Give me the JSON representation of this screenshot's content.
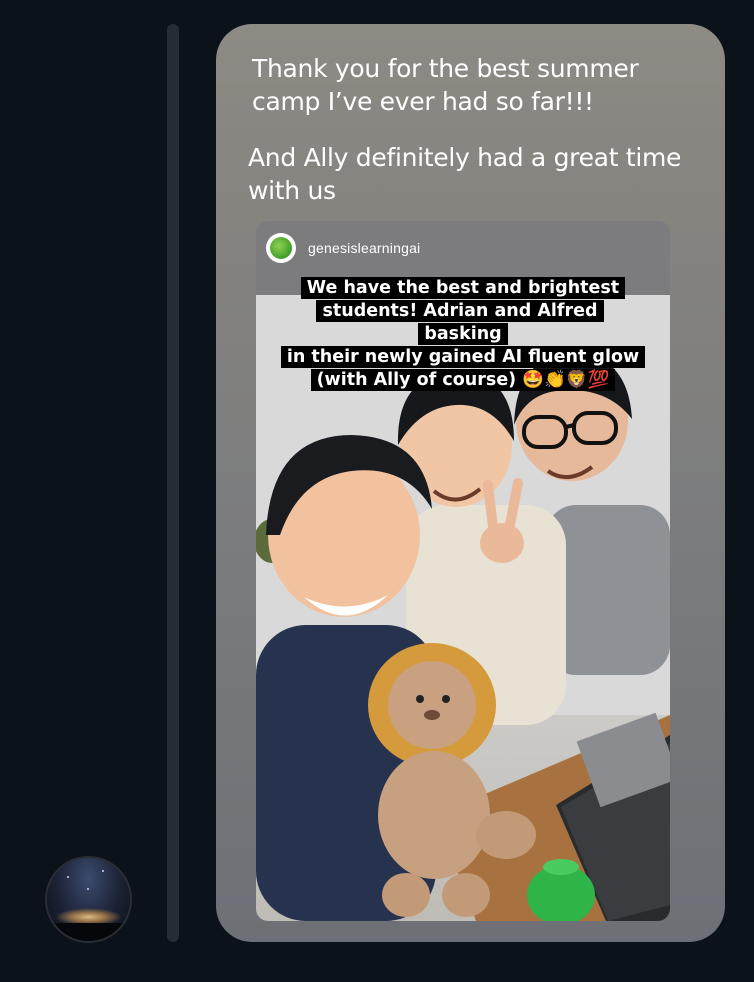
{
  "message": {
    "line1": "Thank you for the best summer camp I’ve ever had so far!!!",
    "line2": "And Ally definitely had a great time with us"
  },
  "story": {
    "username": "genesislearningai",
    "caption_lines": [
      "We have the best and brightest",
      "students! Adrian and Alfred basking",
      "in their newly gained AI fluent glow",
      "(with Ally of course) 🤩👏🦁💯"
    ]
  },
  "colors": {
    "page_bg": "#0c121a",
    "bubble_top": "#8e8a84",
    "bubble_bottom": "#6d7076",
    "caption_bg": "#000000",
    "text": "#ffffff"
  },
  "icons": {
    "story_avatar": "green-leaf-logo",
    "sender_avatar": "night-city-photo"
  }
}
